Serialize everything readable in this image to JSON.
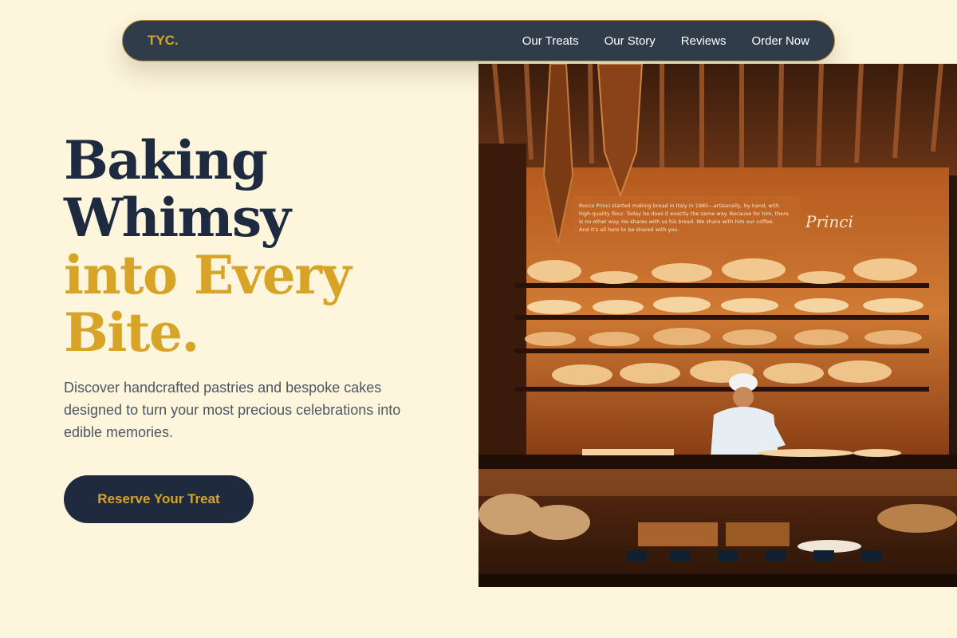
{
  "nav": {
    "logo": "TYC.",
    "links": [
      "Our Treats",
      "Our Story",
      "Reviews",
      "Order Now"
    ]
  },
  "hero": {
    "title_line1": "Baking",
    "title_line2": "Whimsy",
    "title_line3": "into Every",
    "title_line4": "Bite.",
    "description": "Discover handcrafted pastries and bespoke cakes designed to turn your most precious celebrations into edible memories.",
    "cta_label": "Reserve Your Treat"
  },
  "image": {
    "sign_text": "Rocco Princi started making bread in Italy in 1985—artisanally, by hand, with high-quality flour. Today he does it exactly the same way. Because for him, there is no other way. He shares with us his bread. We share with him our coffee. And it's all here to be shared with you.",
    "sign_logo": "Princi"
  },
  "colors": {
    "background": "#fdf5dc",
    "navy": "#1e2a40",
    "gold": "#d8a427",
    "nav_bg": "#313c4b"
  }
}
